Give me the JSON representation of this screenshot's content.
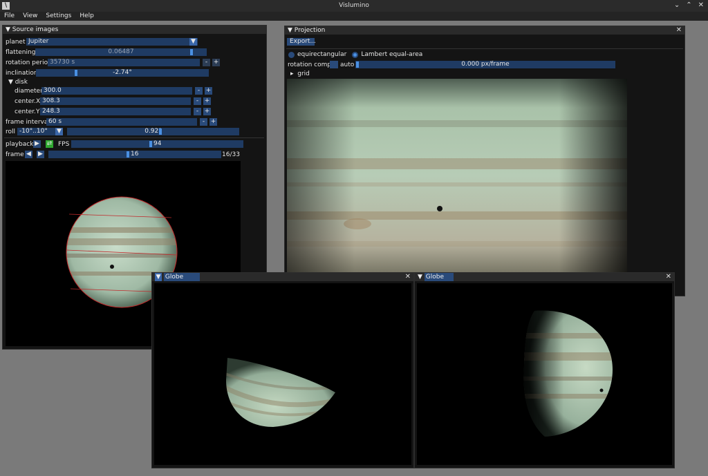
{
  "app": {
    "title": "Vislumino",
    "icon_letter": "\\"
  },
  "window_buttons": {
    "minimize": "⌄",
    "maximize": "⌃",
    "close": "✕"
  },
  "menu": [
    "File",
    "View",
    "Settings",
    "Help"
  ],
  "source": {
    "title": "Source images",
    "planet_label": "planet",
    "planet_value": "Jupiter",
    "flattening_label": "flattening",
    "flattening_value": "0.06487",
    "rotation_label": "rotation period",
    "rotation_value": "35730 s",
    "inclination_label": "inclination",
    "inclination_value": "-2.74°",
    "disk_label": "disk",
    "diameter_label": "diameter",
    "diameter_value": "300.0",
    "cx_label": "center.X",
    "cx_value": "308.3",
    "cy_label": "center.Y",
    "cy_value": "248.3",
    "interval_label": "frame interval",
    "interval_value": "60 s",
    "roll_label": "roll",
    "roll_range": "-10°..10°",
    "roll_value": "0.92°",
    "playback_label": "playback",
    "fps_label": "FPS",
    "fps_value": "94",
    "frame_label": "frame",
    "frame_value": "16",
    "frame_count": "16/33",
    "minus": "-",
    "plus": "+",
    "play": "▶",
    "prev": "◀",
    "loop": "⇄"
  },
  "projection": {
    "title": "Projection",
    "export_label": "Export...",
    "option1": "equirectangular",
    "option2": "Lambert equal-area",
    "rotation_label": "rotation comp.",
    "auto_label": "auto",
    "rotation_value": "0.000 px/frame",
    "grid_label": "grid"
  },
  "globe1": {
    "title": "Globe"
  },
  "globe2": {
    "title": "Globe"
  },
  "colors": {
    "accent": "#294a7a",
    "slider": "#4a90e2",
    "field": "#1f3b63",
    "green": "#2fa82f"
  }
}
